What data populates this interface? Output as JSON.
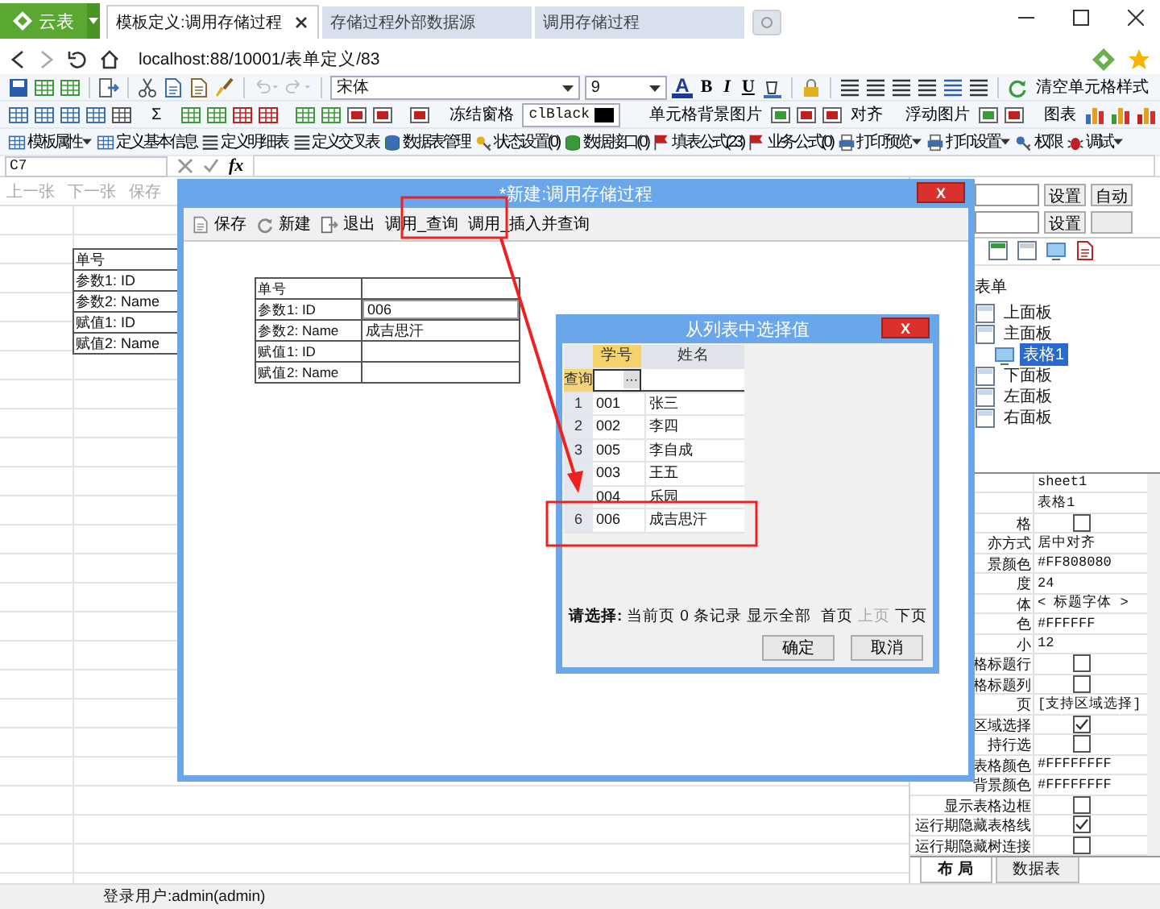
{
  "browser": {
    "app_button": "云表",
    "tabs": [
      {
        "label": "模板定义:调用存储过程",
        "selected": true
      },
      {
        "label": "存储过程外部数据源",
        "selected": false
      },
      {
        "label": "调用存储过程",
        "selected": false
      }
    ],
    "url": "localhost:88/10001/表单定义/83"
  },
  "toolbar_1": {
    "font": "宋体",
    "size": "9",
    "font_color": "A",
    "format_buttons": [
      "B",
      "I",
      "U"
    ],
    "clear_style": "清空单元格样式"
  },
  "toolbar_2": {
    "sum": "Σ",
    "freeze": "冻结窗格",
    "color_value": "clBlack",
    "cell_bg_image": "单元格背景图片",
    "align": "对齐",
    "float_image": "浮动图片",
    "chart": "图表"
  },
  "toolbar_3": [
    {
      "label": "模板属性",
      "dropdown": true
    },
    {
      "label": "定义基本信息",
      "dropdown": false
    },
    {
      "label": "定义明细表",
      "dropdown": false
    },
    {
      "label": "定义交叉表",
      "dropdown": false
    },
    {
      "label": "数据表管理",
      "dropdown": false
    },
    {
      "label": "状态设置(0)",
      "dropdown": false
    },
    {
      "label": "数据接口(0)",
      "dropdown": false
    },
    {
      "label": "填表公式(23)",
      "dropdown": false
    },
    {
      "label": "业务公式(0)",
      "dropdown": false
    },
    {
      "label": "打印预览",
      "dropdown": true
    },
    {
      "label": "打印设置",
      "dropdown": true
    },
    {
      "label": "权限",
      "dropdown": false
    },
    {
      "label": "调试",
      "dropdown": true
    }
  ],
  "formula_bar": {
    "cell": "C7",
    "fx": "fx"
  },
  "sheet": {
    "toolbar": [
      {
        "label": "上一张",
        "disabled": true
      },
      {
        "label": "下一张",
        "disabled": true
      },
      {
        "label": "保存",
        "disabled": true
      }
    ],
    "cells": [
      "单号",
      "参数1: ID",
      "参数2: Name",
      "赋值1: ID",
      "赋值2: Name"
    ]
  },
  "right_panel": {
    "buttons": [
      "设置",
      "自动",
      "设置"
    ],
    "tree": {
      "label": "表单",
      "children": [
        {
          "label": "上面板",
          "selected": false
        },
        {
          "label": "主面板",
          "selected": false,
          "children": [
            {
              "label": "表格1",
              "selected": true
            }
          ]
        },
        {
          "label": "下面板",
          "selected": false
        },
        {
          "label": "左面板",
          "selected": false
        },
        {
          "label": "右面板",
          "selected": false
        }
      ]
    },
    "properties": [
      {
        "kind": "text",
        "value": "sheet1"
      },
      {
        "kind": "text",
        "value": "表格1"
      },
      {
        "kind": "check",
        "name": "格",
        "checked": false
      },
      {
        "kind": "text",
        "name": "亦方式",
        "value": "居中对齐"
      },
      {
        "kind": "text",
        "name": "景颜色",
        "value": "#FF808080"
      },
      {
        "kind": "text",
        "name": "度",
        "value": "24"
      },
      {
        "kind": "text",
        "name": "体",
        "value": "< 标题字体 >"
      },
      {
        "kind": "text",
        "name": "色",
        "value": "#FFFFFF"
      },
      {
        "kind": "text",
        "name": "小",
        "value": "12"
      },
      {
        "kind": "check",
        "name": "格标题行",
        "checked": false
      },
      {
        "kind": "check",
        "name": "格标题列",
        "checked": false
      },
      {
        "kind": "text",
        "name": "页",
        "value": "[支持区域选择]"
      },
      {
        "kind": "check",
        "name": "区域选择",
        "checked": true
      },
      {
        "kind": "check",
        "name": "持行选",
        "checked": false
      },
      {
        "kind": "text",
        "name": "表格颜色",
        "value": "#FFFFFFFF"
      },
      {
        "kind": "text",
        "name": "背景颜色",
        "value": "#FFFFFFFF"
      },
      {
        "kind": "check",
        "name": "显示表格边框",
        "checked": false
      },
      {
        "kind": "check",
        "name": "运行期隐藏表格线",
        "checked": true
      },
      {
        "kind": "check",
        "name": "运行期隐藏树连接",
        "checked": false
      }
    ],
    "tabs": [
      {
        "label": "布 局",
        "selected": true
      },
      {
        "label": "数据表",
        "selected": false
      }
    ]
  },
  "status_bar": "登录用户:admin(admin)",
  "dialog": {
    "title": "*新建:调用存储过程",
    "close": "X",
    "toolbar": [
      {
        "label": "保存",
        "kind": "save"
      },
      {
        "label": "新建",
        "kind": "new"
      },
      {
        "label": "退出",
        "kind": "exit"
      },
      {
        "label": "调用_查询",
        "kind": "plain"
      },
      {
        "label": "调用_插入并查询",
        "kind": "plain"
      }
    ],
    "form": [
      {
        "label": "单号"
      },
      {
        "label": "参数1: ID",
        "value": "006",
        "editing": true
      },
      {
        "label": "参数2: Name",
        "value": "成吉思汗"
      },
      {
        "label": "赋值1: ID"
      },
      {
        "label": "赋值2: Name"
      }
    ]
  },
  "picker": {
    "title": "从列表中选择值",
    "close": "X",
    "columns": [
      {
        "label": "学号",
        "selected": true
      },
      {
        "label": "姓名",
        "selected": false
      }
    ],
    "filter_label": "查询",
    "filter_button": "···",
    "rows": [
      {
        "num": "1",
        "id": "001",
        "name": "张三"
      },
      {
        "num": "2",
        "id": "002",
        "name": "李四"
      },
      {
        "num": "3",
        "id": "005",
        "name": "李自成"
      },
      {
        "id": "003",
        "name": "王五"
      },
      {
        "id": "004",
        "name": "乐园"
      },
      {
        "num": "6",
        "id": "006",
        "name": "成吉思汗"
      }
    ],
    "footer": [
      {
        "label": "请选择:",
        "kind": "label"
      },
      {
        "label": "当前页",
        "kind": "link"
      },
      {
        "label": "0",
        "kind": "count"
      },
      {
        "label": "条记录",
        "kind": "text"
      },
      {
        "label": "显示全部",
        "kind": "link"
      },
      {
        "label": "首页",
        "kind": "link"
      },
      {
        "label": "上页",
        "kind": "disabled"
      },
      {
        "label": "下页",
        "kind": "link"
      }
    ],
    "buttons": [
      "确定",
      "取消"
    ]
  }
}
